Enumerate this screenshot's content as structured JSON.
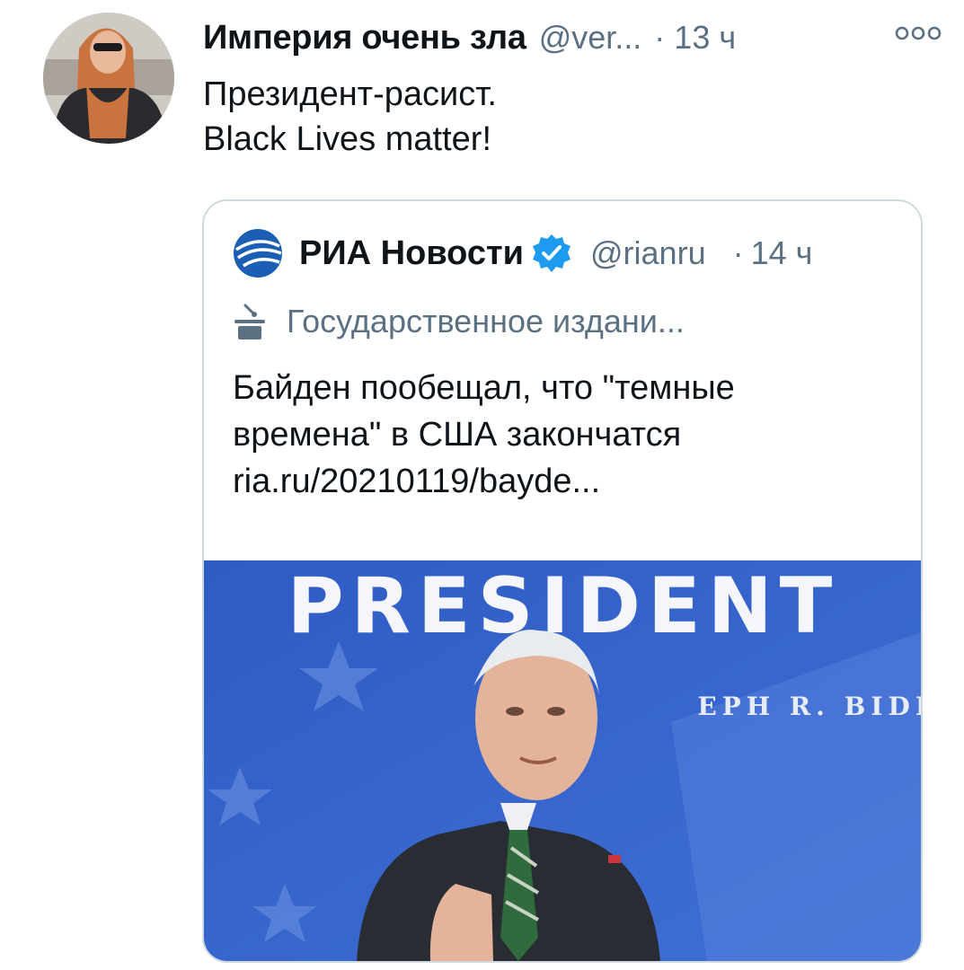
{
  "tweet": {
    "author_name": "Империя очень зла",
    "author_handle": "@ver...",
    "separator": "·",
    "time": "13 ч",
    "text_lines": [
      "Президент-расист.",
      "Black Lives matter!"
    ]
  },
  "quote": {
    "author_name": "РИА Новости",
    "author_handle": "@rianru",
    "separator": "·",
    "time": "14 ч",
    "label": "Государственное издани...",
    "text_lines": [
      "Байден пообещал, что \"темные",
      "времена\" в США закончатся",
      "ria.ru/20210119/bayde..."
    ],
    "image": {
      "banner_text": "PRESIDENT",
      "sub_text": "EPH R. BIDEN"
    }
  },
  "colors": {
    "secondary_text": "#5b7083",
    "border": "#cfd9de",
    "verified": "#1d9bf0",
    "ria_logo": "#1a5fb4",
    "image_background": "#3a64c8"
  },
  "icons": {
    "more": "more-dots-icon",
    "verified": "verified-badge-icon",
    "label": "state-media-podium-icon",
    "logo": "ria-globe-logo"
  }
}
